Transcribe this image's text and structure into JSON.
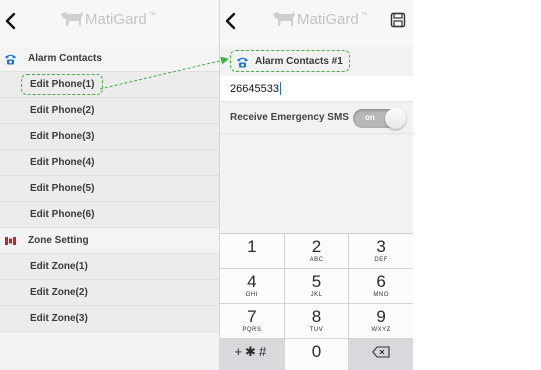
{
  "brand": {
    "name": "MatiGard",
    "tm": "™"
  },
  "left_screen": {
    "sections": [
      {
        "label": "Alarm Contacts",
        "icon": "phone-icon",
        "items": [
          "Edit Phone(1)",
          "Edit Phone(2)",
          "Edit Phone(3)",
          "Edit Phone(4)",
          "Edit Phone(5)",
          "Edit Phone(6)"
        ]
      },
      {
        "label": "Zone Setting",
        "icon": "zone-icon",
        "items": [
          "Edit Zone(1)",
          "Edit Zone(2)",
          "Edit Zone(3)"
        ]
      }
    ]
  },
  "right_screen": {
    "section_label": "Alarm Contacts #1",
    "phone_value": "26645533",
    "sms_label": "Receive Emergency SMS",
    "toggle_label": "on",
    "keypad": [
      {
        "d": "1",
        "s": ""
      },
      {
        "d": "2",
        "s": "ABC"
      },
      {
        "d": "3",
        "s": "DEF"
      },
      {
        "d": "4",
        "s": "GHI"
      },
      {
        "d": "5",
        "s": "JKL"
      },
      {
        "d": "6",
        "s": "MNO"
      },
      {
        "d": "7",
        "s": "PQRS"
      },
      {
        "d": "8",
        "s": "TUV"
      },
      {
        "d": "9",
        "s": "WXYZ"
      },
      {
        "d": "+✱#",
        "s": ""
      },
      {
        "d": "0",
        "s": ""
      },
      {
        "d": "⌫",
        "s": ""
      }
    ]
  },
  "colors": {
    "accent_blue": "#1a73d9",
    "zone_red": "#c0282d",
    "highlight_green": "#3db23d"
  }
}
